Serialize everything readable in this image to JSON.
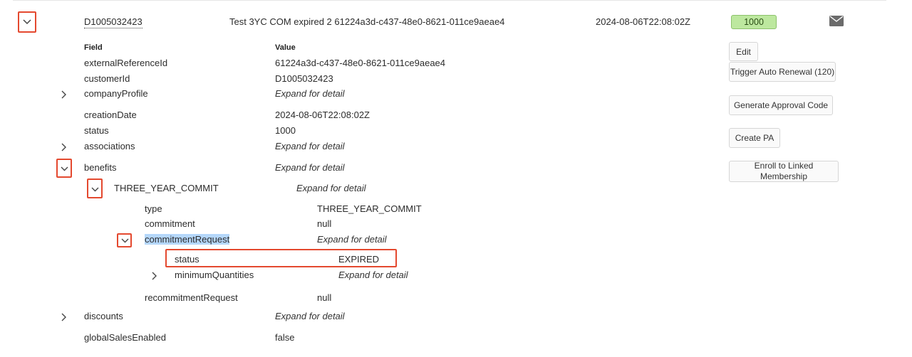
{
  "header_row": {
    "id": "D1005032423",
    "description": "Test 3YC COM expired 2 61224a3d-c437-48e0-8621-011ce9aeae4",
    "date": "2024-08-06T22:08:02Z",
    "status_badge": "1000",
    "badge_color": "#bde89f",
    "mail_icon": "envelope-icon"
  },
  "table": {
    "field_header": "Field",
    "value_header": "Value"
  },
  "rows": {
    "externalReferenceId": {
      "field": "externalReferenceId",
      "value": "61224a3d-c437-48e0-8621-011ce9aeae4"
    },
    "customerId": {
      "field": "customerId",
      "value": "D1005032423"
    },
    "companyProfile": {
      "field": "companyProfile",
      "value": "Expand for detail"
    },
    "creationDate": {
      "field": "creationDate",
      "value": "2024-08-06T22:08:02Z"
    },
    "status": {
      "field": "status",
      "value": "1000"
    },
    "associations": {
      "field": "associations",
      "value": "Expand for detail"
    },
    "benefits": {
      "field": "benefits",
      "value": "Expand for detail"
    },
    "three_year_commit": {
      "field": "THREE_YEAR_COMMIT",
      "value": "Expand for detail"
    },
    "type": {
      "field": "type",
      "value": "THREE_YEAR_COMMIT"
    },
    "commitment": {
      "field": "commitment",
      "value": "null"
    },
    "commitmentRequest": {
      "field": "commitmentRequest",
      "value": "Expand for detail"
    },
    "cr_status": {
      "field": "status",
      "value": "EXPIRED"
    },
    "minimumQuantities": {
      "field": "minimumQuantities",
      "value": "Expand for detail"
    },
    "recommitmentRequest": {
      "field": "recommitmentRequest",
      "value": "null"
    },
    "discounts": {
      "field": "discounts",
      "value": "Expand for detail"
    },
    "globalSalesEnabled": {
      "field": "globalSalesEnabled",
      "value": "false"
    }
  },
  "actions": {
    "edit": "Edit",
    "trigger_auto_renewal": "Trigger Auto Renewal (120)",
    "generate_approval_code": "Generate Approval Code",
    "create_pa": "Create PA",
    "enroll_linked_membership": "Enroll to Linked Membership"
  },
  "colors": {
    "highlight_border": "#e4492f",
    "selection": "#b5d7fb"
  }
}
